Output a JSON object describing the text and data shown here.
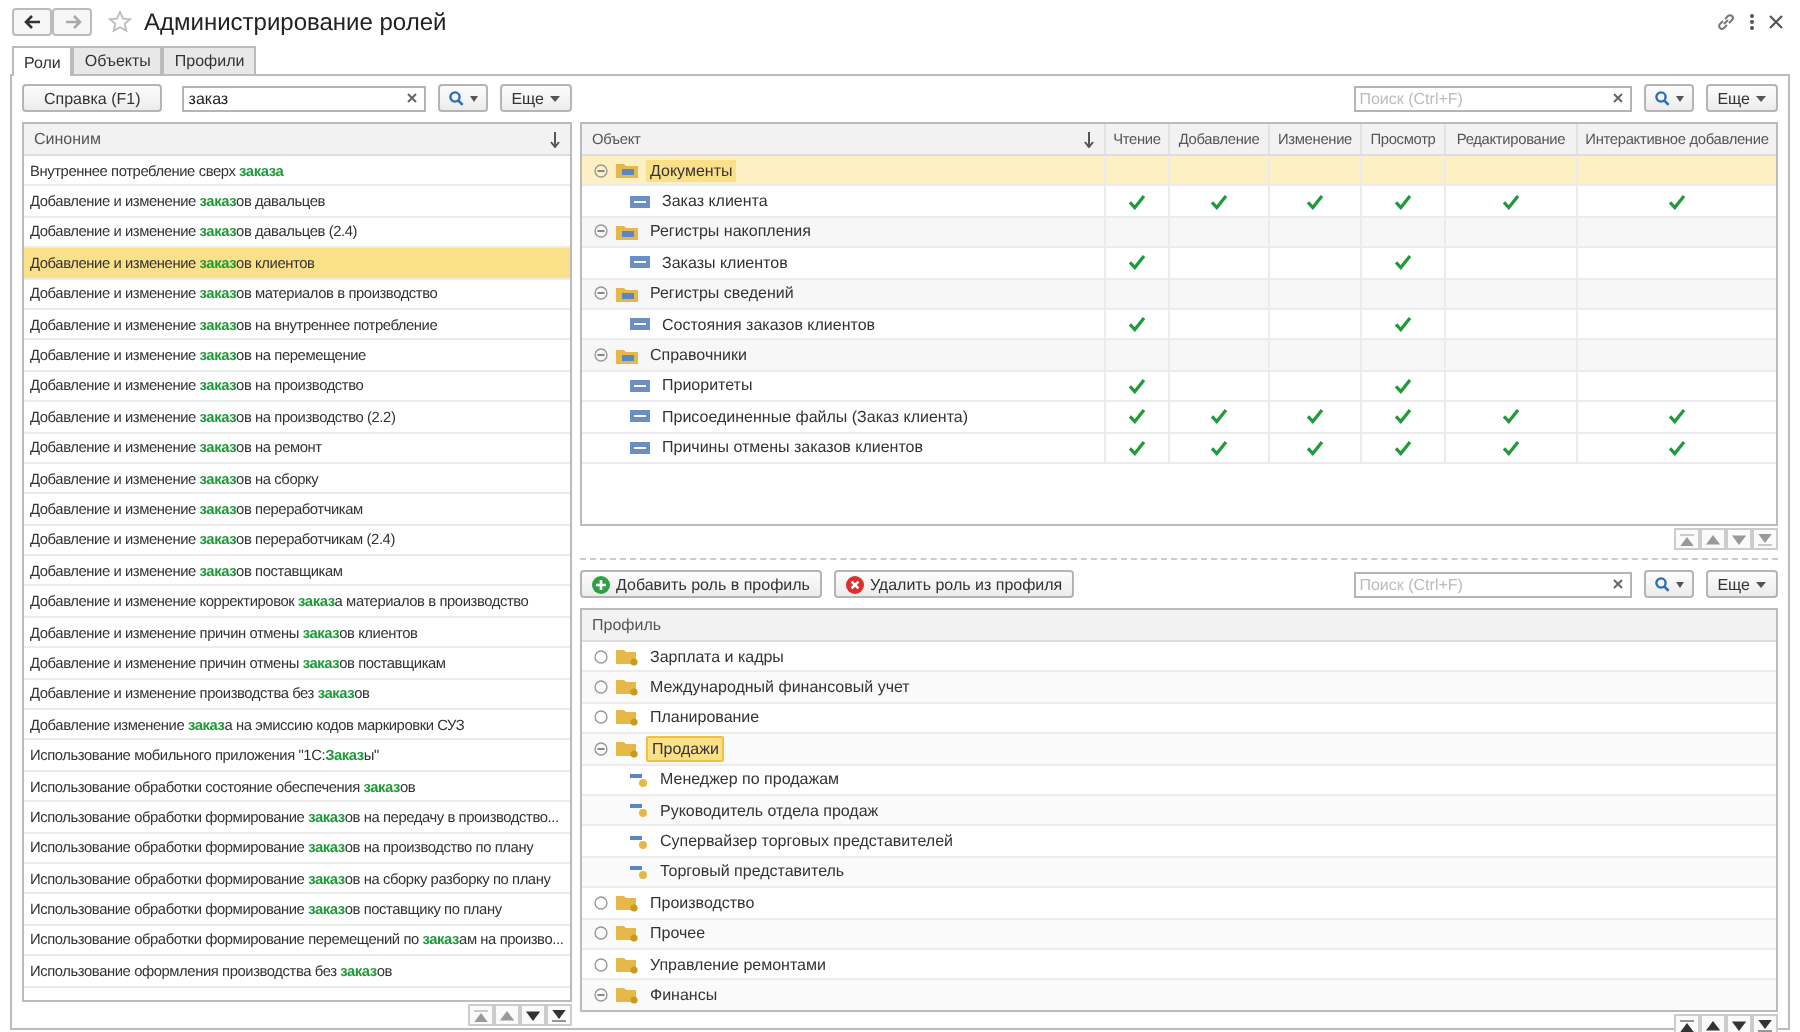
{
  "header": {
    "title": "Администрирование ролей"
  },
  "tabs": [
    {
      "label": "Роли",
      "selected": true
    },
    {
      "label": "Объекты",
      "selected": false
    },
    {
      "label": "Профили",
      "selected": false
    }
  ],
  "roles_toolbar": {
    "help_button": "Справка (F1)",
    "search_value": "заказ",
    "more_button": "Еще"
  },
  "roles": {
    "column": "Синоним",
    "rows": [
      {
        "text": "Внутреннее потребление сверх **заказа**",
        "selected": false
      },
      {
        "text": "Добавление и изменение **заказ**ов давальцев",
        "selected": false
      },
      {
        "text": "Добавление и изменение **заказ**ов давальцев (2.4)",
        "selected": false
      },
      {
        "text": "Добавление и изменение **заказ**ов клиентов",
        "selected": true
      },
      {
        "text": "Добавление и изменение **заказ**ов материалов в производство",
        "selected": false
      },
      {
        "text": "Добавление и изменение **заказ**ов на внутреннее потребление",
        "selected": false
      },
      {
        "text": "Добавление и изменение **заказ**ов на перемещение",
        "selected": false
      },
      {
        "text": "Добавление и изменение **заказ**ов на производство",
        "selected": false
      },
      {
        "text": "Добавление и изменение **заказ**ов на производство (2.2)",
        "selected": false
      },
      {
        "text": "Добавление и изменение **заказ**ов на ремонт",
        "selected": false
      },
      {
        "text": "Добавление и изменение **заказ**ов на сборку",
        "selected": false
      },
      {
        "text": "Добавление и изменение **заказ**ов переработчикам",
        "selected": false
      },
      {
        "text": "Добавление и изменение **заказ**ов переработчикам (2.4)",
        "selected": false
      },
      {
        "text": "Добавление и изменение **заказ**ов поставщикам",
        "selected": false
      },
      {
        "text": "Добавление и изменение корректировок **заказ**а материалов в производство",
        "selected": false
      },
      {
        "text": "Добавление и изменение причин отмены **заказ**ов клиентов",
        "selected": false
      },
      {
        "text": "Добавление и изменение причин отмены **заказ**ов поставщикам",
        "selected": false
      },
      {
        "text": "Добавление и изменение производства без **заказ**ов",
        "selected": false
      },
      {
        "text": "Добавление изменение **заказ**а на эмиссию кодов маркировки СУЗ",
        "selected": false
      },
      {
        "text": "Использование мобильного приложения \"1С:**Заказ**ы\"",
        "selected": false
      },
      {
        "text": "Использование обработки состояние обеспечения **заказ**ов",
        "selected": false
      },
      {
        "text": "Использование обработки формирование **заказ**ов на передачу в производство...",
        "selected": false
      },
      {
        "text": "Использование обработки формирование **заказ**ов на производство по плану",
        "selected": false
      },
      {
        "text": "Использование обработки формирование **заказ**ов на сборку разборку по плану",
        "selected": false
      },
      {
        "text": "Использование обработки формирование **заказ**ов поставщику по плану",
        "selected": false
      },
      {
        "text": "Использование обработки формирование перемещений по **заказ**ам на произво...",
        "selected": false
      },
      {
        "text": "Использование оформления производства без **заказ**ов",
        "selected": false
      }
    ]
  },
  "objects_toolbar": {
    "search_placeholder": "Поиск (Ctrl+F)",
    "more_button": "Еще"
  },
  "objects": {
    "columns": [
      "Объект",
      "Чтение",
      "Добавление",
      "Изменение",
      "Просмотр",
      "Редактирование",
      "Интерактивное добавление"
    ],
    "groups": [
      {
        "name": "Документы",
        "expanded": true,
        "selected": true,
        "children": [
          {
            "name": "Заказ клиента",
            "rights": [
              true,
              true,
              true,
              true,
              true,
              true
            ]
          }
        ]
      },
      {
        "name": "Регистры накопления",
        "expanded": true,
        "selected": false,
        "children": [
          {
            "name": "Заказы клиентов",
            "rights": [
              true,
              false,
              false,
              true,
              false,
              false
            ]
          }
        ]
      },
      {
        "name": "Регистры сведений",
        "expanded": true,
        "selected": false,
        "children": [
          {
            "name": "Состояния заказов клиентов",
            "rights": [
              true,
              false,
              false,
              true,
              false,
              false
            ]
          }
        ]
      },
      {
        "name": "Справочники",
        "expanded": true,
        "selected": false,
        "children": [
          {
            "name": "Приоритеты",
            "rights": [
              true,
              false,
              false,
              true,
              false,
              false
            ]
          },
          {
            "name": "Присоединенные файлы (Заказ клиента)",
            "rights": [
              true,
              true,
              true,
              true,
              true,
              true
            ]
          },
          {
            "name": "Причины отмены заказов клиентов",
            "rights": [
              true,
              true,
              true,
              true,
              true,
              true
            ]
          }
        ]
      }
    ]
  },
  "profile_actions": {
    "add_button": "Добавить роль в профиль",
    "remove_button": "Удалить роль из профиля",
    "search_placeholder": "Поиск (Ctrl+F)",
    "more_button": "Еще"
  },
  "profiles": {
    "column": "Профиль",
    "items": [
      {
        "name": "Зарплата и кадры",
        "expanded": false,
        "selected": false
      },
      {
        "name": "Международный финансовый учет",
        "expanded": false,
        "selected": false
      },
      {
        "name": "Планирование",
        "expanded": false,
        "selected": false
      },
      {
        "name": "Продажи",
        "expanded": true,
        "selected": true,
        "children": [
          {
            "name": "Менеджер по продажам"
          },
          {
            "name": "Руководитель отдела продаж"
          },
          {
            "name": "Супервайзер торговых представителей"
          },
          {
            "name": "Торговый представитель"
          }
        ]
      },
      {
        "name": "Производство",
        "expanded": false,
        "selected": false
      },
      {
        "name": "Прочее",
        "expanded": false,
        "selected": false
      },
      {
        "name": "Управление ремонтами",
        "expanded": false,
        "selected": false
      },
      {
        "name": "Финансы",
        "expanded": true,
        "selected": false
      }
    ]
  }
}
